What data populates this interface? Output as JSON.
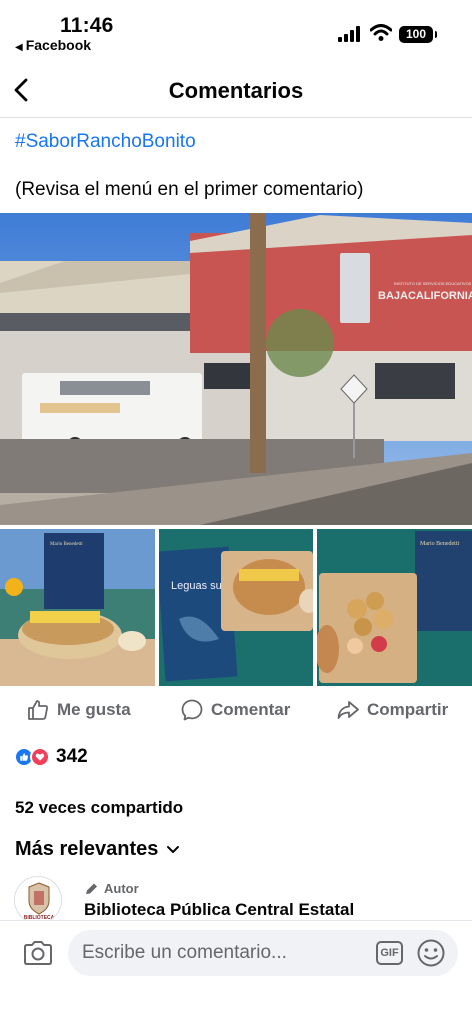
{
  "status": {
    "time": "11:46",
    "back_app": "Facebook",
    "battery": "100"
  },
  "header": {
    "title": "Comentarios"
  },
  "post": {
    "hashtag": "#SaborRanchoBonito",
    "text": "(Revisa el menú en el primer comentario)",
    "building_sign": "BAJACALIFORNIA",
    "building_small": "INSTITUTO DE SERVICIOS EDUCATIVOS",
    "book1_author": "Mario Benedetti",
    "book2_title": "Leguas submarino",
    "book3_author": "Mario Benedetti"
  },
  "actions": {
    "like": "Me gusta",
    "comment": "Comentar",
    "share": "Compartir"
  },
  "reactions": {
    "count": "342"
  },
  "shares": "52 veces compartido",
  "sort": {
    "label": "Más relevantes"
  },
  "comment": {
    "badge": "Autor",
    "author": "Biblioteca Pública Central Estatal",
    "avatar_text": "BIBLIOTECA"
  },
  "composer": {
    "placeholder": "Escribe un comentario...",
    "gif": "GIF"
  },
  "colors": {
    "accent": "#1876f2",
    "secondary_text": "#65676b",
    "like": "#1877f2",
    "love": "#f33e58"
  },
  "icons": [
    "chevron-left-icon",
    "thumbs-up-icon",
    "comment-bubble-icon",
    "share-arrow-icon",
    "chevron-down-icon",
    "pencil-icon",
    "camera-icon",
    "gif-icon",
    "emoji-icon",
    "signal-icon",
    "wifi-icon",
    "battery-icon"
  ]
}
